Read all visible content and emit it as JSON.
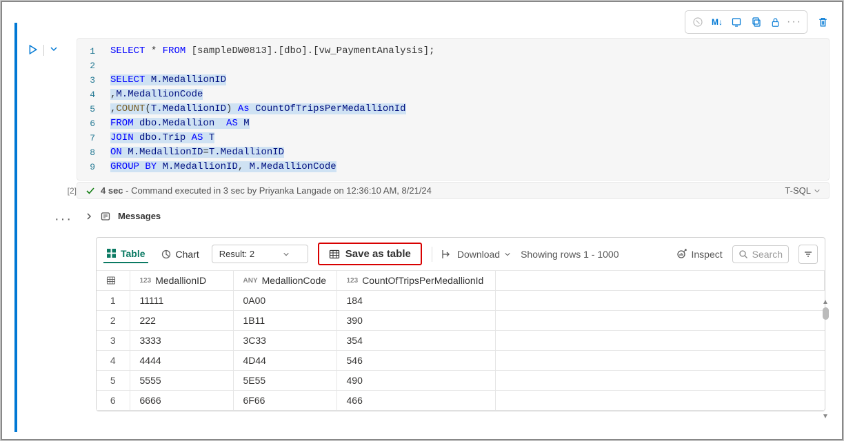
{
  "toolbar_icons": {
    "markdown_label": "M↓"
  },
  "code": {
    "lines": [
      [
        {
          "t": "kw",
          "v": "SELECT"
        },
        {
          "t": "p",
          "v": " * "
        },
        {
          "t": "kw",
          "v": "FROM"
        },
        {
          "t": "p",
          "v": " [sampleDW0813].[dbo].[vw_PaymentAnalysis];"
        }
      ],
      [],
      [
        {
          "t": "kw",
          "v": "SELECT",
          "s": true
        },
        {
          "t": "p",
          "v": " ",
          "s": true
        },
        {
          "t": "id",
          "v": "M.MedallionID",
          "s": true
        }
      ],
      [
        {
          "t": "p",
          "v": ",",
          "s": true
        },
        {
          "t": "id",
          "v": "M.MedallionCode",
          "s": true
        }
      ],
      [
        {
          "t": "p",
          "v": ",",
          "s": true
        },
        {
          "t": "fn",
          "v": "COUNT",
          "s": true
        },
        {
          "t": "p",
          "v": "(",
          "s": true
        },
        {
          "t": "id",
          "v": "T.MedallionID",
          "s": true
        },
        {
          "t": "p",
          "v": ")",
          "s": true
        },
        {
          "t": "p",
          "v": " ",
          "s": true
        },
        {
          "t": "kw",
          "v": "As",
          "s": true
        },
        {
          "t": "p",
          "v": " ",
          "s": true
        },
        {
          "t": "id",
          "v": "CountOfTripsPerMedallionId",
          "s": true
        }
      ],
      [
        {
          "t": "kw",
          "v": "FROM",
          "s": true
        },
        {
          "t": "p",
          "v": " ",
          "s": true
        },
        {
          "t": "id",
          "v": "dbo.Medallion",
          "s": true
        },
        {
          "t": "p",
          "v": "  ",
          "s": true
        },
        {
          "t": "kw",
          "v": "AS",
          "s": true
        },
        {
          "t": "p",
          "v": " ",
          "s": true
        },
        {
          "t": "id",
          "v": "M",
          "s": true
        }
      ],
      [
        {
          "t": "kw",
          "v": "JOIN",
          "s": true
        },
        {
          "t": "p",
          "v": " ",
          "s": true
        },
        {
          "t": "id",
          "v": "dbo.Trip",
          "s": true
        },
        {
          "t": "p",
          "v": " ",
          "s": true
        },
        {
          "t": "kw",
          "v": "AS",
          "s": true
        },
        {
          "t": "p",
          "v": " ",
          "s": true
        },
        {
          "t": "id",
          "v": "T",
          "s": true
        }
      ],
      [
        {
          "t": "kw",
          "v": "ON",
          "s": true
        },
        {
          "t": "p",
          "v": " ",
          "s": true
        },
        {
          "t": "id",
          "v": "M.MedallionID",
          "s": true
        },
        {
          "t": "p",
          "v": "=",
          "s": true
        },
        {
          "t": "id",
          "v": "T.MedallionID",
          "s": true
        }
      ],
      [
        {
          "t": "kw",
          "v": "GROUP BY",
          "s": true
        },
        {
          "t": "p",
          "v": " ",
          "s": true
        },
        {
          "t": "id",
          "v": "M.MedallionID",
          "s": true
        },
        {
          "t": "p",
          "v": ", ",
          "s": true
        },
        {
          "t": "id",
          "v": "M.MedallionCode",
          "s": true
        }
      ]
    ]
  },
  "execution": {
    "index": "[2]",
    "duration_label": "4 sec",
    "status_text": " - Command executed in 3 sec by Priyanka Langade on 12:36:10 AM, 8/21/24",
    "language_label": "T-SQL"
  },
  "messages_label": "Messages",
  "results": {
    "tab_table": "Table",
    "tab_chart": "Chart",
    "result_select": "Result: 2",
    "save_as_table": "Save as table",
    "download": "Download",
    "rows_showing": "Showing rows 1 - 1000",
    "inspect": "Inspect",
    "search_placeholder": "Search"
  },
  "table": {
    "columns": [
      {
        "type": "123",
        "name": "MedallionID"
      },
      {
        "type": "ANY",
        "name": "MedallionCode"
      },
      {
        "type": "123",
        "name": "CountOfTripsPerMedallionId"
      }
    ],
    "rows": [
      {
        "n": "1",
        "MedallionID": "11111",
        "MedallionCode": "0A00",
        "CountOfTripsPerMedallionId": "184"
      },
      {
        "n": "2",
        "MedallionID": "222",
        "MedallionCode": "1B11",
        "CountOfTripsPerMedallionId": "390"
      },
      {
        "n": "3",
        "MedallionID": "3333",
        "MedallionCode": "3C33",
        "CountOfTripsPerMedallionId": "354"
      },
      {
        "n": "4",
        "MedallionID": "4444",
        "MedallionCode": "4D44",
        "CountOfTripsPerMedallionId": "546"
      },
      {
        "n": "5",
        "MedallionID": "5555",
        "MedallionCode": "5E55",
        "CountOfTripsPerMedallionId": "490"
      },
      {
        "n": "6",
        "MedallionID": "6666",
        "MedallionCode": "6F66",
        "CountOfTripsPerMedallionId": "466"
      }
    ]
  }
}
